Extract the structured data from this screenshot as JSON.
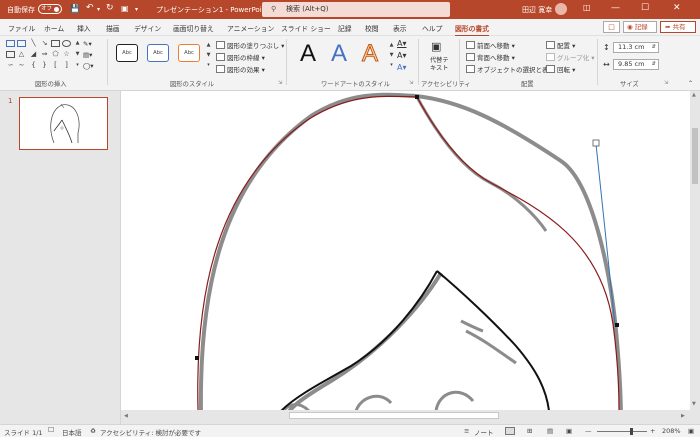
{
  "titlebar": {
    "autosave_label": "自動保存",
    "autosave_state": "オフ",
    "doc_title": "プレゼンテーション1 - PowerPoint",
    "search_placeholder": "検索 (Alt+Q)",
    "user_name": "田辺 寛幸",
    "color": "#b7472a"
  },
  "tabs": [
    "ファイル",
    "ホーム",
    "挿入",
    "描画",
    "デザイン",
    "画面切り替え",
    "アニメーション",
    "スライド ショー",
    "記録",
    "校閲",
    "表示",
    "ヘルプ",
    "図形の書式"
  ],
  "active_tab": "図形の書式",
  "top_right": {
    "record_label": "記録",
    "share_label": "共有"
  },
  "ribbon": {
    "groups": {
      "insert_shapes": "図形の挿入",
      "shape_styles": "図形のスタイル",
      "wordart_styles": "ワードアートのスタイル",
      "accessibility": "アクセシビリティ",
      "arrange": "配置",
      "size": "サイズ"
    },
    "style_samples": [
      "Abc",
      "Abc",
      "Abc"
    ],
    "shape_fill": "図形の塗りつぶし",
    "shape_outline": "図形の枠線",
    "shape_effects": "図形の効果",
    "wordart_letters": [
      "A",
      "A",
      "A"
    ],
    "alt_text_line1": "代替テ",
    "alt_text_line2": "キスト",
    "bring_forward": "前面へ移動",
    "send_backward": "背面へ移動",
    "selection_pane": "オブジェクトの選択と表示",
    "align": "配置",
    "group": "グループ化",
    "rotate": "回転",
    "height": "11.3 cm",
    "width": "9.85 cm"
  },
  "slides_panel": {
    "slide_number": "1"
  },
  "statusbar": {
    "slide_info": "スライド 1/1",
    "language": "日本語",
    "accessibility": "アクセシビリティ: 検討が必要です",
    "notes": "ノート",
    "zoom": "208%"
  }
}
